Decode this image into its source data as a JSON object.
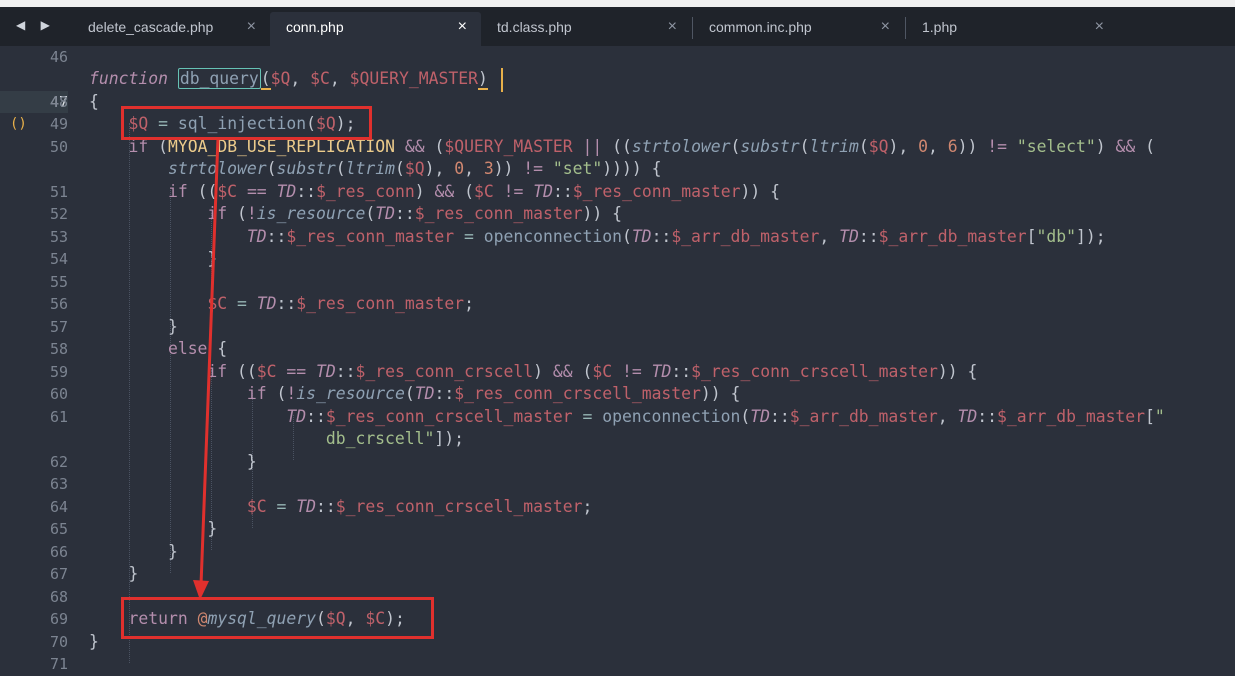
{
  "tabs": [
    {
      "label": "delete_cascade.php",
      "close": "×",
      "active": false
    },
    {
      "label": "conn.php",
      "close": "×",
      "active": true
    },
    {
      "label": "td.class.php",
      "close": "×",
      "active": false
    },
    {
      "label": "common.inc.php",
      "close": "×",
      "active": false
    },
    {
      "label": "1.php",
      "close": "×",
      "active": false
    }
  ],
  "nav_arrows": "◀ ▶",
  "gutter": {
    "current_line": "47",
    "bracket_marker": "()",
    "line_numbers": [
      "46",
      "47",
      "48",
      "49",
      "50",
      "",
      "51",
      "52",
      "53",
      "54",
      "55",
      "56",
      "57",
      "58",
      "59",
      "60",
      "61",
      "",
      "62",
      "63",
      "64",
      "65",
      "66",
      "67",
      "68",
      "69",
      "70",
      "71"
    ]
  },
  "code": {
    "l47": {
      "kw": "function",
      "name": "db_query",
      "p1": "$Q",
      "p2": "$C",
      "p3": "$QUERY_MASTER"
    },
    "l49": {
      "var": "$Q",
      "fn": "sql_injection",
      "arg": "$Q"
    },
    "l50": {
      "const": "MYOA_DB_USE_REPLICATION",
      "var": "$QUERY_MASTER",
      "fn1": "strtolower",
      "fn2": "substr",
      "fn3": "ltrim",
      "arg": "$Q",
      "n0": "0",
      "n6": "6",
      "str": "\"select\""
    },
    "l50b": {
      "fn1": "strtolower",
      "fn2": "substr",
      "fn3": "ltrim",
      "arg": "$Q",
      "n0": "0",
      "n3": "3",
      "str": "\"set\""
    },
    "l51": {
      "var": "$C",
      "cls": "TD",
      "prop": "$_res_conn",
      "prop2": "$_res_conn_master"
    },
    "l52": {
      "fn": "is_resource",
      "cls": "TD",
      "prop": "$_res_conn_master"
    },
    "l53": {
      "cls": "TD",
      "prop": "$_res_conn_master",
      "fn": "openconnection",
      "arg": "$_arr_db_master",
      "key": "\"db\""
    },
    "l56": {
      "var": "$C",
      "cls": "TD",
      "prop": "$_res_conn_master"
    },
    "l58": {
      "kw": "else"
    },
    "l59": {
      "var": "$C",
      "cls": "TD",
      "prop": "$_res_conn_crscell",
      "prop2": "$_res_conn_crscell_master"
    },
    "l60": {
      "fn": "is_resource",
      "cls": "TD",
      "prop": "$_res_conn_crscell_master"
    },
    "l61": {
      "cls": "TD",
      "prop": "$_res_conn_crscell_master",
      "fn": "openconnection",
      "arg": "$_arr_db_master",
      "key_start": "\""
    },
    "l61b": {
      "key_end": "db_crscell\""
    },
    "l64": {
      "var": "$C",
      "cls": "TD",
      "prop": "$_res_conn_crscell_master"
    },
    "l69": {
      "kw": "return",
      "at": "@",
      "fn": "mysql_query",
      "a1": "$Q",
      "a2": "$C"
    }
  },
  "colors": {
    "background": "#2b303b",
    "keyword": "#b48ead",
    "function": "#8fa1b3",
    "variable": "#bf616a",
    "number": "#d08770",
    "string": "#a3be8c",
    "annotation": "#e0302d"
  }
}
